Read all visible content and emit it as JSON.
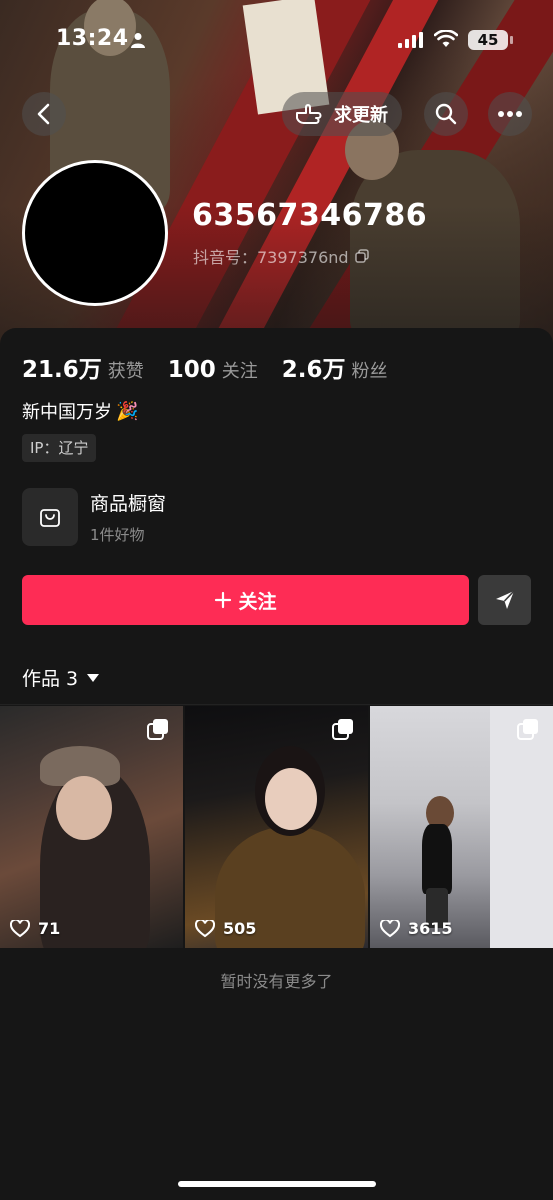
{
  "status_bar": {
    "time": "13:24",
    "battery": "45"
  },
  "nav": {
    "update_label": "求更新"
  },
  "profile": {
    "nickname": "63567346786",
    "douyin_id": "抖音号：7397376nd",
    "stats": [
      {
        "num": "21.6万",
        "label": "获赞"
      },
      {
        "num": "100",
        "label": "关注"
      },
      {
        "num": "2.6万",
        "label": "粉丝"
      }
    ],
    "bio": "新中国万岁",
    "bio_emoji": "🎉",
    "ip": "IP：辽宁"
  },
  "shop": {
    "title": "商品橱窗",
    "subtitle": "1件好物"
  },
  "actions": {
    "follow_label": "关注"
  },
  "works": {
    "tab_label": "作品 3",
    "items": [
      {
        "likes": "71"
      },
      {
        "likes": "505"
      },
      {
        "likes": "3615"
      }
    ],
    "end_text": "暂时没有更多了"
  },
  "colors": {
    "accent": "#fe2c55",
    "background": "#161616"
  }
}
